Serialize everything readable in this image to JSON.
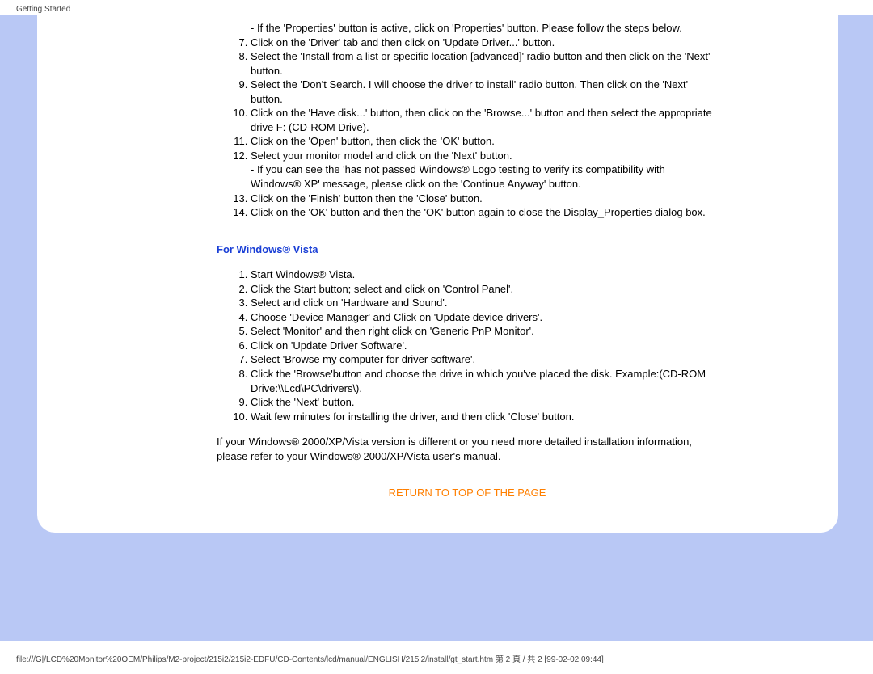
{
  "header": {
    "title": "Getting Started"
  },
  "xp": {
    "note1": "- If the 'Properties' button is active, click on 'Properties' button. Please follow the steps below.",
    "step7": "Click on the 'Driver' tab and then click on 'Update Driver...' button.",
    "step8": "Select the 'Install from a list or specific location [advanced]' radio button and then click on the 'Next' button.",
    "step9": "Select the 'Don't Search. I will choose the driver to install' radio button. Then click on the 'Next' button.",
    "step10": "Click on the 'Have disk...' button, then click on the 'Browse...' button and then select the appropriate drive F: (CD-ROM Drive).",
    "step11": "Click on the 'Open' button, then click the 'OK' button.",
    "step12": "Select your monitor model and click on the 'Next' button.",
    "note2": "- If you can see the 'has not passed Windows® Logo testing to verify its compatibility with Windows® XP' message, please click on the 'Continue Anyway' button.",
    "step13": "Click on the 'Finish' button then the 'Close' button.",
    "step14": "Click on the 'OK' button and then the 'OK' button again to close the Display_Properties dialog box."
  },
  "vista": {
    "heading": "For Windows® Vista",
    "step1": "Start Windows® Vista.",
    "step2": "Click the Start button; select and click on 'Control Panel'.",
    "step3": "Select and click on 'Hardware and Sound'.",
    "step4": "Choose 'Device Manager' and Click on 'Update device drivers'.",
    "step5": "Select 'Monitor' and then right click on 'Generic PnP Monitor'.",
    "step6": "Click on 'Update Driver Software'.",
    "step7": "Select 'Browse my computer for driver software'.",
    "step8": "Click the 'Browse'button and choose the drive in which you've placed the disk. Example:(CD-ROM Drive:\\\\Lcd\\PC\\drivers\\).",
    "step9": "Click the 'Next' button.",
    "step10": "Wait few minutes for installing the driver, and then click 'Close' button."
  },
  "closing": "If your Windows® 2000/XP/Vista version is different or you need more detailed installation information, please refer to your Windows® 2000/XP/Vista user's manual.",
  "return_link": "RETURN TO TOP OF THE PAGE",
  "footer": "file:///G|/LCD%20Monitor%20OEM/Philips/M2-project/215i2/215i2-EDFU/CD-Contents/lcd/manual/ENGLISH/215i2/install/gt_start.htm 第 2 頁 / 共 2 [99-02-02 09:44]"
}
